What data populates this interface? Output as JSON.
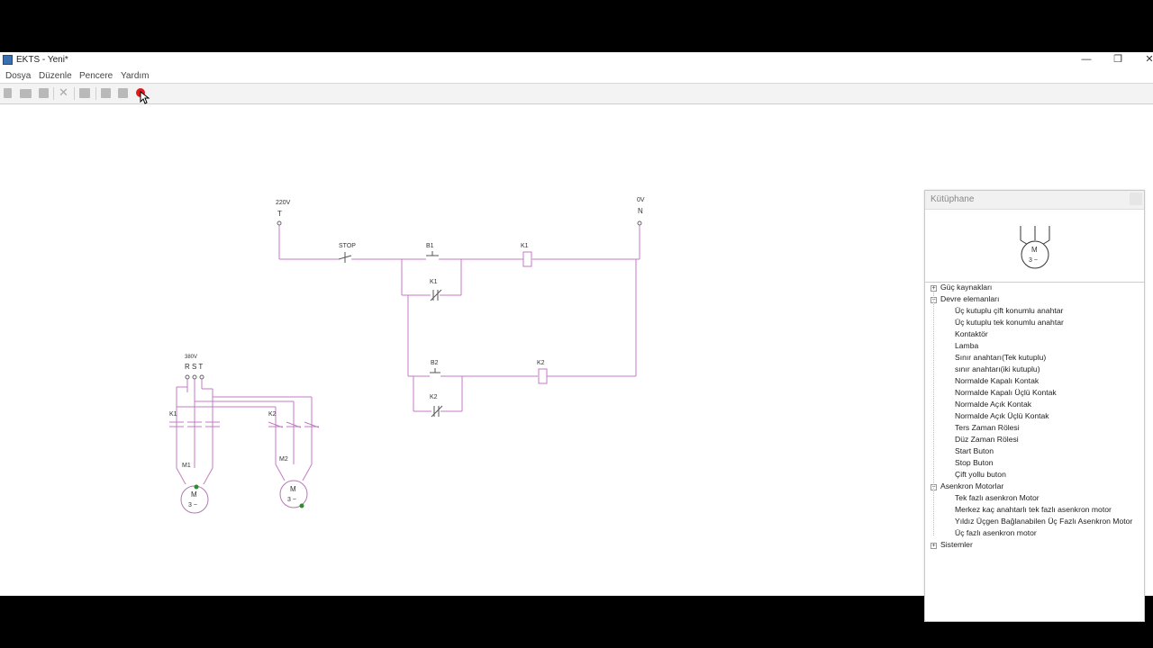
{
  "window": {
    "title": "EKTS - Yeni*",
    "minimize": "—",
    "restore": "❐",
    "close": "✕"
  },
  "menu": [
    "Dosya",
    "Düzenle",
    "Pencere",
    "Yardım"
  ],
  "toolbar": [
    "new-file-icon",
    "open-folder-icon",
    "save-icon",
    "delete-icon",
    "print-icon",
    "component-icon",
    "component2-icon",
    "record-icon"
  ],
  "colors": {
    "wire": "#c47ac4",
    "accent_record": "#e01b1b",
    "terminal_green": "#2e8b2e"
  },
  "circuit": {
    "supply_left_voltage": "220V",
    "supply_left_phase": "T",
    "supply_right_voltage": "0V",
    "supply_right_neutral": "N",
    "stop_label": "STOP",
    "b1_label": "B1",
    "k1_coil_label": "K1",
    "k1_contact_label": "K1",
    "b2_label": "B2",
    "k2_coil_label": "K2",
    "k2_contact_label": "K2",
    "power_voltage": "380V",
    "power_phases": "R S T",
    "power_k1_label": "K1",
    "power_k2_label": "K2",
    "motor1_label": "M1",
    "motor2_label": "M2",
    "motor_symbol": "M",
    "motor_phase": "3 ~"
  },
  "library": {
    "title": "Kütüphane",
    "preview_motor_symbol": "M",
    "preview_motor_phase": "3 ~",
    "tree": [
      {
        "label": "Güç kaynakları",
        "level": 0,
        "expander": "+"
      },
      {
        "label": "Devre elemanları",
        "level": 0,
        "expander": "−"
      },
      {
        "label": "Üç kutuplu çift konumlu anahtar",
        "level": 1
      },
      {
        "label": "Üç kutuplu tek konumlu anahtar",
        "level": 1
      },
      {
        "label": "Kontaktör",
        "level": 1
      },
      {
        "label": "Lamba",
        "level": 1
      },
      {
        "label": "Sınır anahtarı(Tek kutuplu)",
        "level": 1
      },
      {
        "label": "sınır anahtarı(iki kutuplu)",
        "level": 1
      },
      {
        "label": "Normalde Kapalı Kontak",
        "level": 1
      },
      {
        "label": "Normalde Kapalı Üçlü Kontak",
        "level": 1
      },
      {
        "label": "Normalde Açık Kontak",
        "level": 1
      },
      {
        "label": "Normalde Açık Üçlü Kontak",
        "level": 1
      },
      {
        "label": "Ters Zaman Rölesi",
        "level": 1
      },
      {
        "label": "Düz Zaman Rölesi",
        "level": 1
      },
      {
        "label": "Start Buton",
        "level": 1
      },
      {
        "label": "Stop Buton",
        "level": 1
      },
      {
        "label": "Çift yollu buton",
        "level": 1
      },
      {
        "label": "Asenkron Motorlar",
        "level": 0,
        "expander": "−"
      },
      {
        "label": "Tek fazlı asenkron Motor",
        "level": 1
      },
      {
        "label": "Merkez kaç anahtarlı tek fazlı asenkron motor",
        "level": 1
      },
      {
        "label": "Yıldız Üçgen Bağlanabilen Üç Fazlı Asenkron Motor",
        "level": 1
      },
      {
        "label": "Üç fazlı asenkron motor",
        "level": 1
      },
      {
        "label": "Sistemler",
        "level": 0,
        "expander": "+"
      }
    ]
  }
}
